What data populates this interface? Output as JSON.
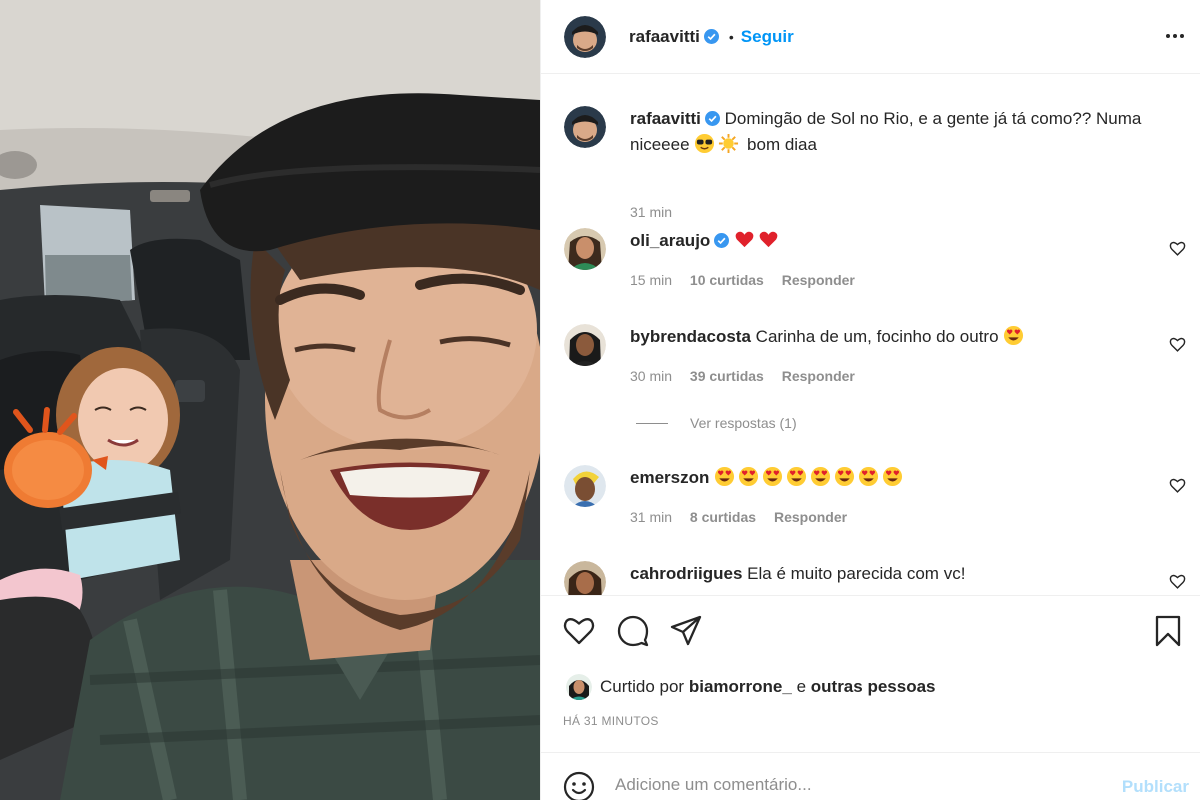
{
  "post": {
    "author": "rafaavitti",
    "separator": "•",
    "follow_label": "Seguir",
    "caption": {
      "username": "rafaavitti",
      "text": "Domingão de Sol no Rio, e a gente já tá como?? Numa niceeee",
      "text_after": "bom diaa",
      "time": "31 min"
    }
  },
  "comments": [
    {
      "username": "oli_araujo",
      "verified": true,
      "text": "",
      "emojis": [
        "red-heart",
        "red-heart"
      ],
      "time": "15 min",
      "likes": "10 curtidas",
      "reply": "Responder"
    },
    {
      "username": "bybrendacosta",
      "verified": false,
      "text": "Carinha de um, focinho do outro",
      "emojis": [
        "heart-eyes"
      ],
      "time": "30 min",
      "likes": "39 curtidas",
      "reply": "Responder"
    },
    {
      "username": "emerszon",
      "verified": false,
      "text": "",
      "emojis": [
        "heart-eyes",
        "heart-eyes",
        "heart-eyes",
        "heart-eyes",
        "heart-eyes",
        "heart-eyes",
        "heart-eyes",
        "heart-eyes"
      ],
      "time": "31 min",
      "likes": "8 curtidas",
      "reply": "Responder"
    },
    {
      "username": "cahrodriigues",
      "verified": false,
      "text": "Ela é muito parecida com vc!",
      "emojis": []
    }
  ],
  "view_replies": "Ver respostas (1)",
  "liked_by": {
    "prefix": "Curtido por",
    "user": "biamorrone_",
    "conj": "e",
    "others": "outras pessoas"
  },
  "timestamp": "HÁ 31 MINUTOS",
  "add_comment": {
    "placeholder": "Adicione um comentário...",
    "publish": "Publicar"
  },
  "icons": [
    "more-options-icon",
    "heart-icon",
    "comment-icon",
    "share-icon",
    "bookmark-icon",
    "emoji-icon",
    "verified-badge-icon"
  ],
  "colors": {
    "accent": "#0095f6",
    "publish_disabled": "#b2dffc",
    "secondary_text": "#8e8e8e",
    "border": "#efefef"
  }
}
